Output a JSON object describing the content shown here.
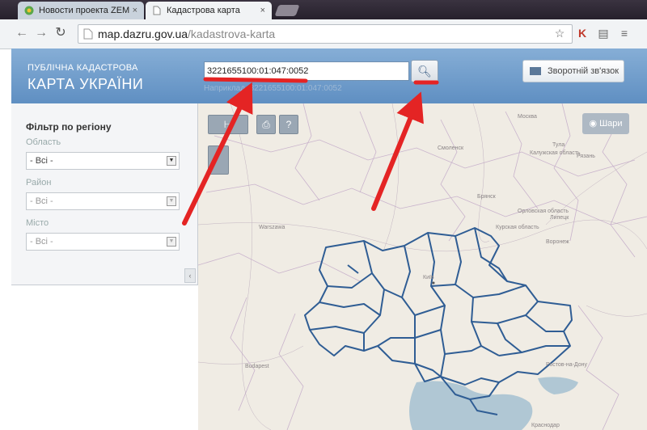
{
  "browser": {
    "tabs": [
      {
        "title": "Новости проекта ZEM.ua",
        "close": "×",
        "active": false
      },
      {
        "title": "Кадастрова карта",
        "close": "×",
        "active": true
      }
    ],
    "url_host": "map.dazru.gov.ua",
    "url_path": "/kadastrova-karta",
    "icons": [
      "back-arrow-icon",
      "forward-arrow-icon",
      "reload-icon",
      "page-icon",
      "star-icon",
      "extension-icon",
      "document-icon",
      "menu-icon"
    ]
  },
  "header": {
    "brand_line1": "ПУБЛІЧНА КАДАСТРОВА",
    "brand_line2": "КАРТА УКРАЇНИ",
    "search_value": "3221655100:01:047:0052",
    "search_hint": "Наприклад, 3221655100:01:047:0052",
    "feedback_label": "Зворотній зв'язок"
  },
  "sidebar": {
    "title": "Фільтр по регіону",
    "filters": [
      {
        "label": "Область",
        "value": "- Всі -"
      },
      {
        "label": "Район",
        "value": "- Всі -"
      },
      {
        "label": "Місто",
        "value": "- Всі -"
      }
    ],
    "collapse": "‹"
  },
  "map": {
    "layers_label": "Шари",
    "controls": {
      "measure": "⊢",
      "print": "⎙",
      "info": "?"
    },
    "labels": {
      "moscow": "Москва",
      "smolensk": "Смоленск",
      "bryansk": "Брянск",
      "kursk": "Курская область",
      "voronezh": "Воронеж",
      "lipetsk": "Липецк",
      "ryazan": "Рязань",
      "tula": "Тула",
      "orel": "Орловская область",
      "kaluga": "Калужская область",
      "warsaw": "Warszawa",
      "kyiv": "Київ",
      "budapest": "Budapest",
      "rostov": "Ростов-на-Дону",
      "krasnodar": "Краснодар"
    },
    "colors": {
      "borders": "#2f5d94",
      "sea": "#a9c3d2",
      "background": "#f0ece4"
    }
  },
  "annotations": {
    "color": "#e42424"
  }
}
